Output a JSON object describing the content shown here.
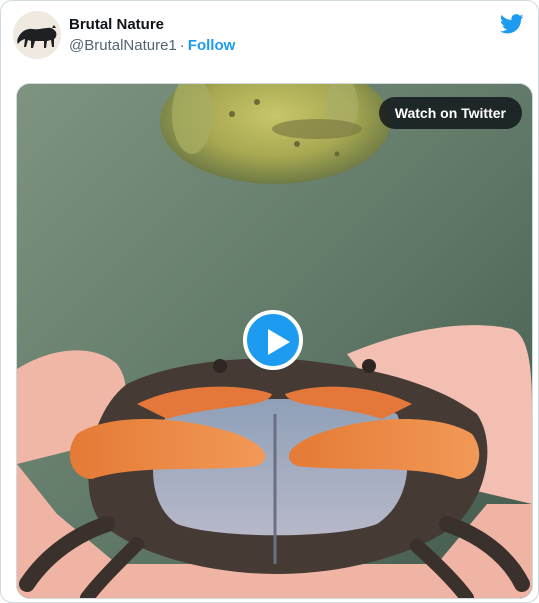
{
  "tweet": {
    "author": {
      "display_name": "Brutal Nature",
      "handle": "@BrutalNature1",
      "avatar_icon": "panther-icon"
    },
    "follow_label": "Follow",
    "separator": "·",
    "brand_icon": "twitter-bird-icon"
  },
  "media": {
    "kind": "video-thumbnail",
    "watch_label": "Watch on Twitter",
    "play_icon": "play-icon"
  },
  "colors": {
    "accent": "#1d9bf0",
    "text_primary": "#0f1419",
    "text_secondary": "#536471",
    "border": "#cfd9de"
  }
}
